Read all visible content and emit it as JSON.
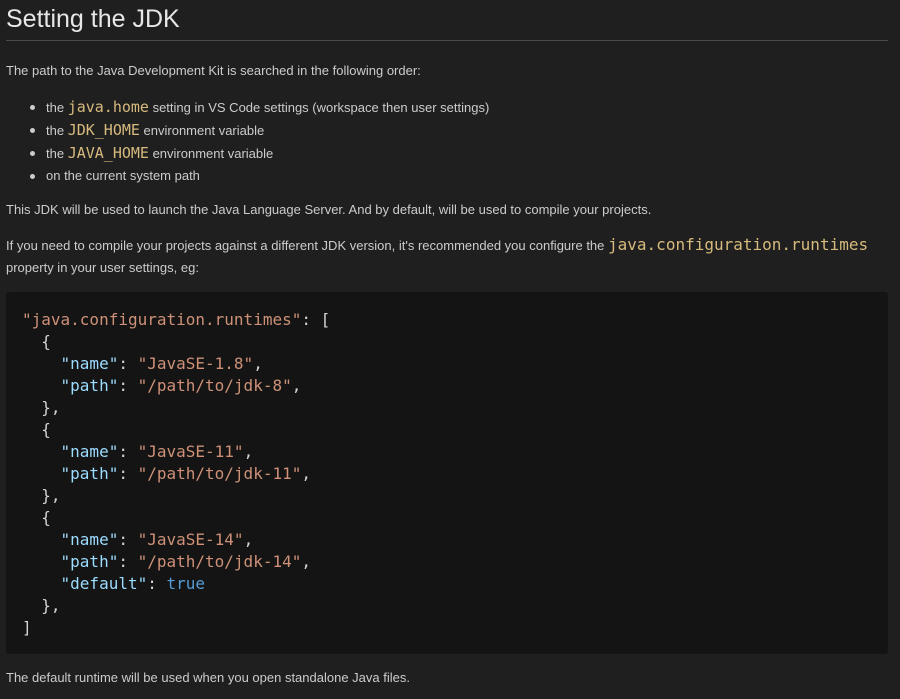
{
  "title": "Setting the JDK",
  "intro": "The path to the Java Development Kit is searched in the following order:",
  "search_order": [
    {
      "prefix": "the ",
      "code": "java.home",
      "suffix": " setting in VS Code settings (workspace then user settings)"
    },
    {
      "prefix": "the ",
      "code": "JDK_HOME",
      "suffix": " environment variable"
    },
    {
      "prefix": "the ",
      "code": "JAVA_HOME",
      "suffix": " environment variable"
    },
    {
      "prefix": "",
      "code": "",
      "suffix": "on the current system path"
    }
  ],
  "jdk_usage": "This JDK will be used to launch the Java Language Server. And by default, will be used to compile your projects.",
  "runtimes_note": {
    "before": "If you need to compile your projects against a different JDK version, it's recommended you configure the ",
    "code": "java.configuration.runtimes",
    "after": "property in your user settings, eg:"
  },
  "code_example": {
    "setting_key": "\"java.configuration.runtimes\"",
    "runtimes": [
      {
        "name": "\"JavaSE-1.8\"",
        "path": "\"/path/to/jdk-8\""
      },
      {
        "name": "\"JavaSE-11\"",
        "path": "\"/path/to/jdk-11\""
      },
      {
        "name": "\"JavaSE-14\"",
        "path": "\"/path/to/jdk-14\"",
        "default": "true"
      }
    ],
    "key_name": "\"name\"",
    "key_path": "\"path\"",
    "key_default": "\"default\""
  },
  "footer_note": "The default runtime will be used when you open standalone Java files.",
  "colors": {
    "background": "#1f1f1f",
    "code_background": "#141414",
    "inline_code": "#d7ba7d",
    "string": "#ce9178",
    "property_key": "#9cdcfe",
    "boolean": "#569cd6"
  }
}
